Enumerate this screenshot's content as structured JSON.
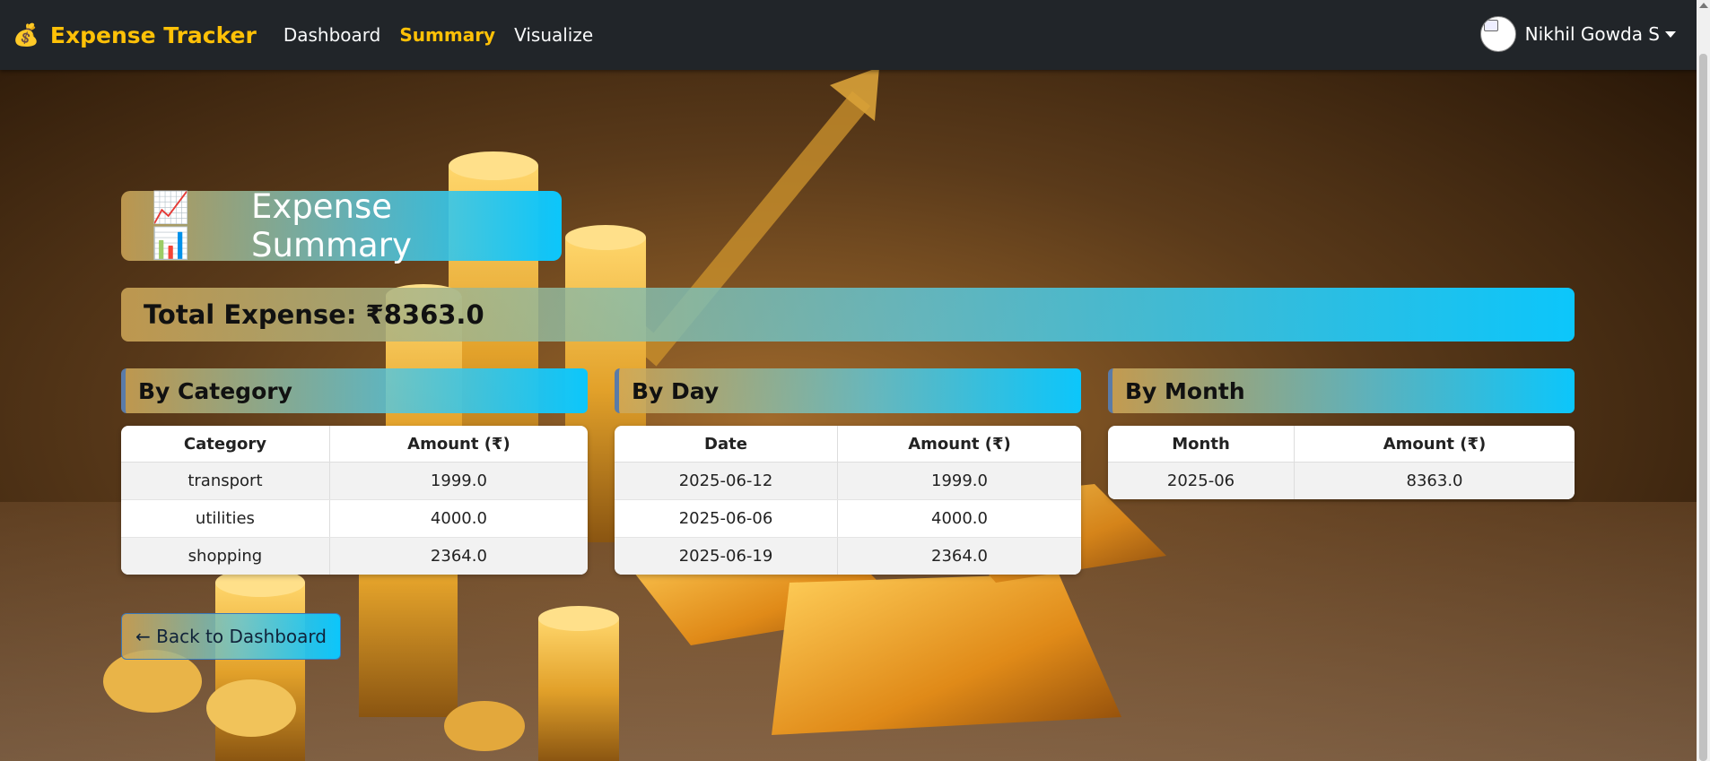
{
  "navbar": {
    "brand_icon": "money-bag-icon",
    "brand_emoji": "💰",
    "brand": "Expense Tracker",
    "links": [
      {
        "label": "Dashboard",
        "active": false
      },
      {
        "label": "Summary",
        "active": true
      },
      {
        "label": "Visualize",
        "active": false
      }
    ],
    "user_name": "Nikhil Gowda S",
    "accent_color": "#ffc107",
    "bg_color": "#212529"
  },
  "page": {
    "title_emojis": "📈 📊",
    "title": "Expense Summary",
    "total_label": "Total Expense: ₹8363.0",
    "back_button": "← Back to Dashboard"
  },
  "sections": {
    "category": {
      "title": "By Category",
      "headers": [
        "Category",
        "Amount (₹)"
      ],
      "rows": [
        [
          "transport",
          "1999.0"
        ],
        [
          "utilities",
          "4000.0"
        ],
        [
          "shopping",
          "2364.0"
        ]
      ]
    },
    "day": {
      "title": "By Day",
      "headers": [
        "Date",
        "Amount (₹)"
      ],
      "rows": [
        [
          "2025-06-12",
          "1999.0"
        ],
        [
          "2025-06-06",
          "4000.0"
        ],
        [
          "2025-06-19",
          "2364.0"
        ]
      ]
    },
    "month": {
      "title": "By Month",
      "headers": [
        "Month",
        "Amount (₹)"
      ],
      "rows": [
        [
          "2025-06",
          "8363.0"
        ]
      ]
    }
  },
  "theme": {
    "gradient_start": "#d0a858",
    "gradient_end": "#0cc6fb"
  }
}
